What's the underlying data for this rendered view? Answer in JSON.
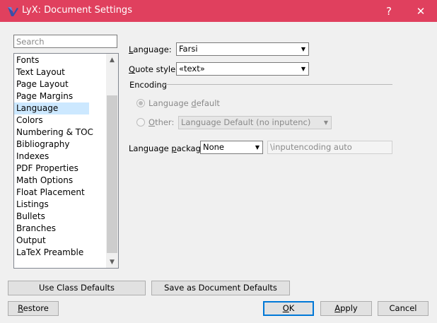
{
  "window": {
    "title": "LyX: Document Settings",
    "help_glyph": "?",
    "close_glyph": "✕",
    "titlebar_color": "#e0405e"
  },
  "sidebar": {
    "search_placeholder": "Search",
    "selected_item": "Language",
    "items": [
      "Fonts",
      "Text Layout",
      "Page Layout",
      "Page Margins",
      "Language",
      "Colors",
      "Numbering & TOC",
      "Bibliography",
      "Indexes",
      "PDF Properties",
      "Math Options",
      "Float Placement",
      "Listings",
      "Bullets",
      "Branches",
      "Output",
      "LaTeX Preamble"
    ],
    "scroll_up_glyph": "▲",
    "scroll_down_glyph": "▼"
  },
  "language_panel": {
    "language_label_mn": "L",
    "language_label_rest": "anguage:",
    "language_value": "Farsi",
    "quote_label_mn": "Q",
    "quote_label_rest": "uote style:",
    "quote_value": "«text»",
    "encoding_group": "Encoding",
    "radio_default_pre": "Language ",
    "radio_default_mn": "d",
    "radio_default_post": "efault",
    "radio_other_mn": "O",
    "radio_other_rest": "ther:",
    "other_encoding_value": "Language Default (no inputenc)",
    "package_label_pre": "Language ",
    "package_label_mn": "p",
    "package_label_post": "ackage:",
    "package_value": "None",
    "package_command": "\\inputencoding auto",
    "combo_arrow": "▼"
  },
  "buttons": {
    "use_class_defaults": "Use Class Defaults",
    "save_as_defaults": "Save as Document Defaults",
    "restore_mn": "R",
    "restore_rest": "estore",
    "ok_mn": "O",
    "ok_rest": "K",
    "apply_mn": "A",
    "apply_rest": "pply",
    "cancel": "Cancel"
  }
}
